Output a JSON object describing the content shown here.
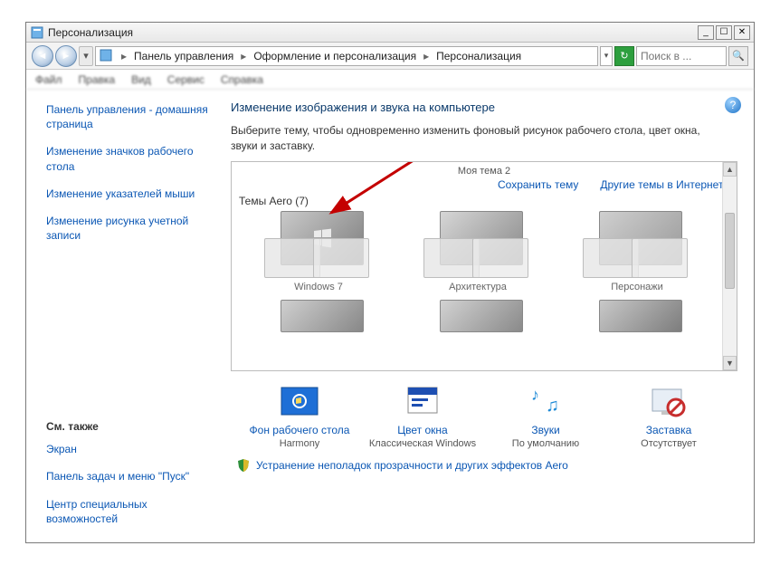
{
  "window": {
    "title": "Персонализация"
  },
  "breadcrumbs": {
    "b1": "Панель управления",
    "b2": "Оформление и персонализация",
    "b3": "Персонализация"
  },
  "search": {
    "placeholder": "Поиск в ..."
  },
  "menubar": {
    "file": "Файл",
    "edit": "Правка",
    "view": "Вид",
    "service": "Сервис",
    "help": "Справка"
  },
  "sidebar": {
    "cp_home": "Панель управления - домашняя страница",
    "change_icons": "Изменение значков рабочего стола",
    "change_cursors": "Изменение указателей мыши",
    "change_picture": "Изменение рисунка учетной записи",
    "see_also": "См. также",
    "screen": "Экран",
    "taskbar": "Панель задач и меню \"Пуск\"",
    "ease": "Центр специальных возможностей"
  },
  "main": {
    "heading": "Изменение изображения и звука на компьютере",
    "sub": "Выберите тему, чтобы одновременно изменить фоновый рисунок рабочего стола, цвет окна, звуки и заставку.",
    "prev_theme": "Моя тема 2",
    "save_theme": "Сохранить тему",
    "online_themes": "Другие темы в Интернете",
    "section": "Темы Aero (7)",
    "themes": [
      {
        "label": "Windows 7"
      },
      {
        "label": "Архитектура"
      },
      {
        "label": "Персонажи"
      }
    ]
  },
  "bottom": {
    "bg": {
      "label": "Фон рабочего стола",
      "value": "Harmony"
    },
    "color": {
      "label": "Цвет окна",
      "value": "Классическая Windows"
    },
    "sounds": {
      "label": "Звуки",
      "value": "По умолчанию"
    },
    "saver": {
      "label": "Заставка",
      "value": "Отсутствует"
    }
  },
  "troubleshoot": "Устранение неполадок прозрачности и других эффектов Aero"
}
